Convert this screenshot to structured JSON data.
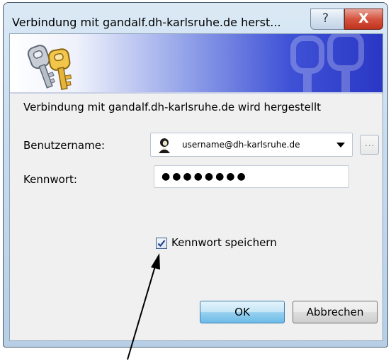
{
  "window": {
    "title": "Verbindung mit gandalf.dh-karlsruhe.de herst...",
    "help_glyph": "?",
    "close_glyph": "X"
  },
  "dialog": {
    "message": "Verbindung mit gandalf.dh-karlsruhe.de wird hergestellt",
    "username_label": "Benutzername:",
    "username_value": "username@dh-karlsruhe.de",
    "browse_label": "...",
    "password_label": "Kennwort:",
    "password_value": "●●●●●●●●",
    "remember_label": "Kennwort speichern",
    "remember_checked": true,
    "ok_label": "OK",
    "cancel_label": "Abbrechen"
  },
  "icons": {
    "banner": "keys-icon",
    "user": "user-icon",
    "combo_arrow": "chevron-down-icon",
    "checkbox": "checkmark-icon"
  },
  "colors": {
    "banner_start": "#ffffff",
    "banner_end": "#2a37c4",
    "ok_border": "#3c7fb1",
    "close_button": "#c0331d"
  }
}
